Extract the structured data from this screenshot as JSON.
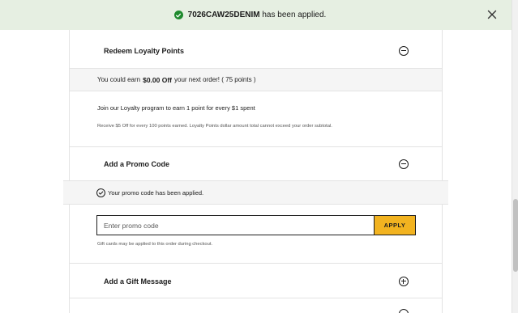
{
  "toast": {
    "code": "7026CAW25DENIM",
    "message": "has been applied."
  },
  "loyalty": {
    "title": "Redeem Loyalty Points",
    "earn_prefix": "You could earn",
    "earn_amount": "$0.00 Off",
    "earn_suffix": "your next order! ( 75 points )",
    "join_text": "Join our Loyalty program to earn 1 point for every $1 spent",
    "fine_print": "Receive $5 Off for every 100 points earned. Loyalty Points dollar amount total cannot exceed your order subtotal."
  },
  "promo": {
    "title": "Add a Promo Code",
    "applied_message": "Your promo code has been applied.",
    "input_placeholder": "Enter promo code",
    "input_value": "",
    "apply_label": "APPLY",
    "gift_note": "Gift cards may be applied to this order during checkout."
  },
  "gift_message": {
    "title": "Add a Gift Message"
  },
  "icons": {
    "toast_status": "check-circle-icon",
    "toast_close": "close-icon",
    "loyalty_toggle": "minus-circle-icon",
    "promo_toggle": "minus-circle-icon",
    "promo_status": "check-circle-outline-icon",
    "gift_toggle": "plus-circle-icon"
  },
  "colors": {
    "toast_background": "#e6efe2",
    "success_green": "#1f8a2e",
    "apply_button": "#f2b320",
    "band_background": "#f5f5f5"
  }
}
